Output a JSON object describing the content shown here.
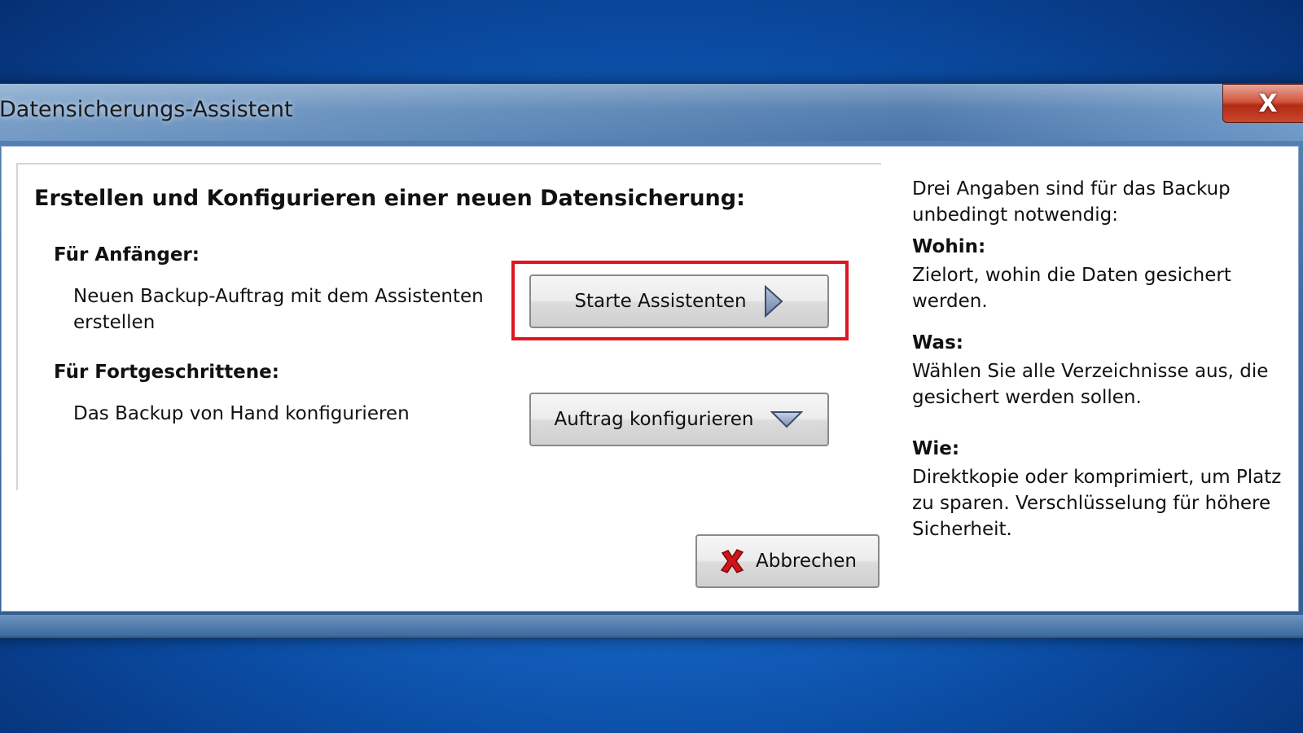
{
  "window": {
    "title": "Datensicherungs-Assistent",
    "close_label": "X"
  },
  "main": {
    "heading": "Erstellen und Konfigurieren einer neuen Datensicherung:",
    "beginner": {
      "label": "Für Anfänger:",
      "description": "Neuen Backup-Auftrag mit dem Assistenten erstellen",
      "button_label": "Starte Assistenten",
      "button_icon": "play-arrow-icon"
    },
    "advanced": {
      "label": "Für Fortgeschrittene:",
      "description": "Das Backup von Hand konfigurieren",
      "button_label": "Auftrag konfigurieren",
      "button_icon": "dropdown-triangle-icon"
    },
    "cancel_label": "Abbrechen",
    "cancel_icon": "red-x-icon"
  },
  "info": {
    "intro": "Drei Angaben sind für das Backup unbedingt notwendig:",
    "items": [
      {
        "heading": "Wohin:",
        "text": "Zielort, wohin die Daten gesichert werden."
      },
      {
        "heading": "Was:",
        "text": "Wählen Sie alle Verzeichnisse aus, die gesichert werden sollen."
      },
      {
        "heading": "Wie:",
        "text": "Direktkopie oder komprimiert, um Platz zu sparen. Verschlüsselung für höhere Sicherheit."
      }
    ]
  },
  "colors": {
    "highlight": "#e0141e",
    "desktop": "#1565c4"
  }
}
